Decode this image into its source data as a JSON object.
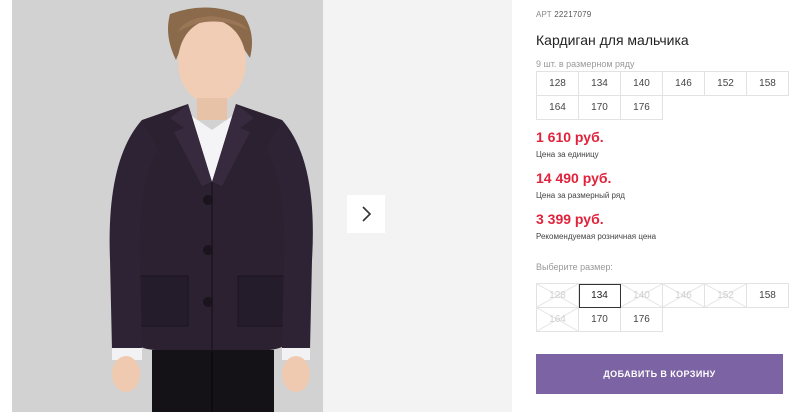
{
  "product": {
    "sku_prefix": "АРТ",
    "sku": "22217079",
    "title": "Кардиган для мальчика",
    "pack_label": "9 шт. в размерном ряду",
    "pack_sizes": [
      "128",
      "134",
      "140",
      "146",
      "152",
      "158",
      "164",
      "170",
      "176"
    ]
  },
  "prices": [
    {
      "amount": "1 610 руб.",
      "note": "Цена за единицу"
    },
    {
      "amount": "14 490 руб.",
      "note": "Цена за размерный ряд"
    },
    {
      "amount": "3 399 руб.",
      "note": "Рекомендуемая розничная цена"
    }
  ],
  "size_select": {
    "label": "Выберите размер:",
    "options": [
      {
        "size": "128",
        "state": "disabled"
      },
      {
        "size": "134",
        "state": "selected"
      },
      {
        "size": "140",
        "state": "disabled"
      },
      {
        "size": "146",
        "state": "disabled"
      },
      {
        "size": "152",
        "state": "disabled"
      },
      {
        "size": "158",
        "state": "available"
      },
      {
        "size": "164",
        "state": "disabled"
      },
      {
        "size": "170",
        "state": "available"
      },
      {
        "size": "176",
        "state": "available"
      }
    ]
  },
  "cart_button": {
    "label": "ДОБАВИТЬ В КОРЗИНУ"
  },
  "gallery": {
    "next_icon": "chevron-right-icon"
  },
  "colors": {
    "accent": "#7b63a4",
    "price": "#e0223b",
    "photo_bg": "#d2d2d2"
  }
}
